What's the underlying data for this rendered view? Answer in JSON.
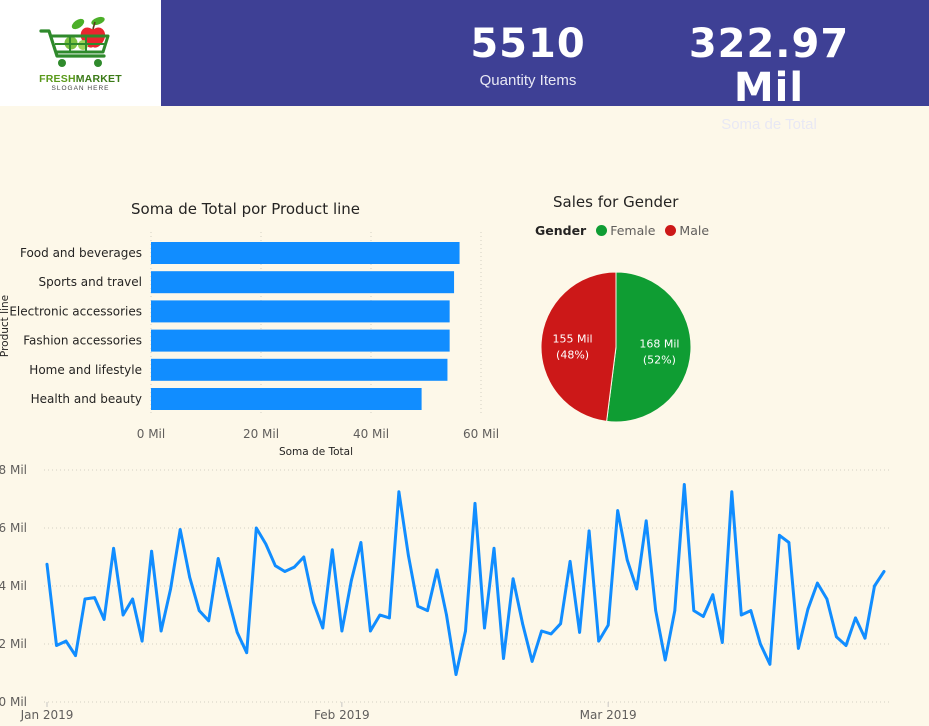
{
  "logo": {
    "brand_part1": "FRESH",
    "brand_part2": "MARKET",
    "slogan": "SLOGAN HERE",
    "icon": "shopping-cart-with-apple-icon",
    "colors": {
      "cart": "#2f8a2c",
      "apple": "#e8252f",
      "leaf": "#4caf29"
    }
  },
  "header": {
    "background": "#3e4095"
  },
  "kpis": [
    {
      "value": "5510",
      "label": "Quantity Items"
    },
    {
      "value": "322.97 Mil",
      "label": "Soma de Total"
    }
  ],
  "chart_data": [
    {
      "type": "bar",
      "orientation": "horizontal",
      "title": "Soma de Total por Product line",
      "xlabel": "Soma de Total",
      "ylabel": "Product line",
      "categories": [
        "Food and beverages",
        "Sports and travel",
        "Electronic accessories",
        "Fashion accessories",
        "Home and lifestyle",
        "Health and beauty"
      ],
      "values": [
        56.1,
        55.1,
        54.3,
        54.3,
        53.9,
        49.2
      ],
      "unit": "Mil",
      "xlim": [
        0,
        60
      ],
      "xticks": [
        0,
        20,
        40,
        60
      ],
      "xtick_labels": [
        "0 Mil",
        "20 Mil",
        "40 Mil",
        "60 Mil"
      ],
      "grid": true,
      "color": "#118dff"
    },
    {
      "type": "pie",
      "title": "Sales for Gender",
      "legend_title": "Gender",
      "legend_position": "top",
      "slices": [
        {
          "name": "Female",
          "value": 168,
          "percent": 52,
          "label": "168 Mil",
          "pct_label": "(52%)",
          "color": "#0f9d33"
        },
        {
          "name": "Male",
          "value": 155,
          "percent": 48,
          "label": "155 Mil",
          "pct_label": "(48%)",
          "color": "#cc1818"
        }
      ]
    },
    {
      "type": "line",
      "ylim": [
        0,
        8
      ],
      "yticks": [
        0,
        2,
        4,
        6,
        8
      ],
      "ytick_labels": [
        "0 Mil",
        "2 Mil",
        "4 Mil",
        "6 Mil",
        "8 Mil"
      ],
      "xlim": [
        "2019-01-01",
        "2019-03-30"
      ],
      "x_tick_labels": [
        {
          "date": "2019-01-01",
          "label": "Jan 2019"
        },
        {
          "date": "2019-02-01",
          "label": "Feb 2019"
        },
        {
          "date": "2019-03-01",
          "label": "Mar 2019"
        }
      ],
      "grid": true,
      "color": "#118dff",
      "values": [
        4.75,
        1.95,
        2.1,
        1.6,
        3.55,
        3.6,
        2.85,
        5.3,
        3.0,
        3.55,
        2.1,
        5.2,
        2.45,
        3.9,
        5.95,
        4.3,
        3.15,
        2.8,
        4.95,
        3.65,
        2.4,
        1.7,
        6.0,
        5.45,
        4.7,
        4.5,
        4.65,
        5.0,
        3.45,
        2.55,
        5.25,
        2.45,
        4.2,
        5.5,
        2.45,
        3.0,
        2.9,
        7.25,
        5.05,
        3.3,
        3.15,
        4.55,
        3.0,
        0.95,
        2.45,
        6.85,
        2.55,
        5.3,
        1.5,
        4.25,
        2.7,
        1.4,
        2.45,
        2.35,
        2.7,
        4.85,
        2.4,
        5.9,
        2.1,
        2.65,
        6.6,
        4.9,
        3.9,
        6.25,
        3.15,
        1.45,
        3.15,
        7.5,
        3.15,
        2.95,
        3.7,
        2.05,
        7.25,
        3.0,
        3.15,
        2.0,
        1.3,
        5.75,
        5.5,
        1.85,
        3.2,
        4.1,
        3.55,
        2.25,
        1.95,
        2.9,
        2.2,
        4.0,
        4.5
      ]
    }
  ]
}
